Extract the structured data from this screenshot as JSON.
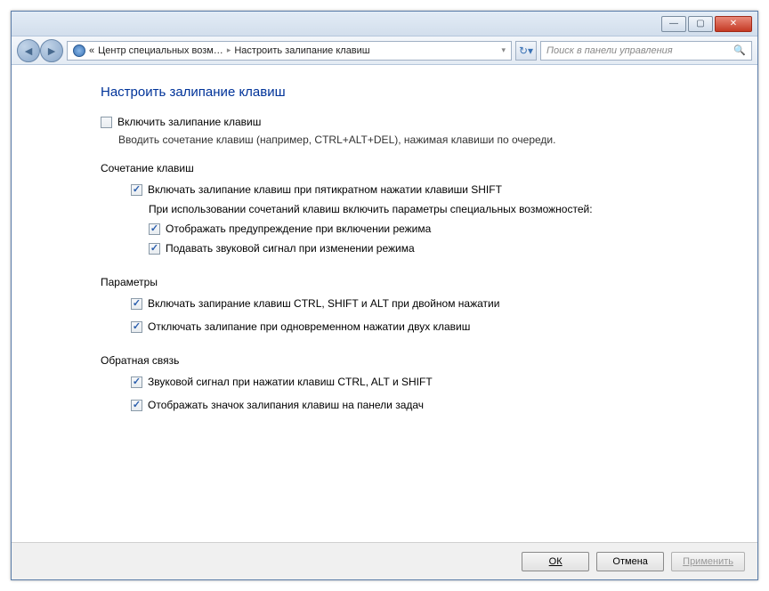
{
  "titlebar": {
    "minimize": "—",
    "maximize": "▢",
    "close": "✕"
  },
  "navbar": {
    "back_arrow": "◄",
    "fwd_arrow": "►",
    "crumb_prefix": "«",
    "crumb1": "Центр специальных возм…",
    "crumb2": "Настроить залипание клавиш",
    "separator": "▸",
    "dropdown": "▾",
    "refresh": "↻▾",
    "search_placeholder": "Поиск в панели управления",
    "search_icon": "🔍"
  },
  "page": {
    "title": "Настроить залипание клавиш",
    "main_checkbox_label": "Включить залипание клавиш",
    "main_description": "Вводить сочетание клавиш (например, CTRL+ALT+DEL), нажимая клавиши по очереди.",
    "sections": {
      "combo": {
        "header": "Сочетание клавиш",
        "opt1_label": "Включать залипание клавиш при пятикратном нажатии клавиши SHIFT",
        "subtext": "При использовании сочетаний клавиш включить параметры специальных возможностей:",
        "opt2_label": "Отображать предупреждение при включении режима",
        "opt3_label": "Подавать звуковой сигнал при изменении режима"
      },
      "params": {
        "header": "Параметры",
        "opt1_label": "Включать запирание клавиш CTRL, SHIFT и ALT при двойном нажатии",
        "opt2_label": "Отключать залипание при одновременном нажатии двух клавиш"
      },
      "feedback": {
        "header": "Обратная связь",
        "opt1_label": "Звуковой сигнал при нажатии клавиш CTRL, ALT и SHIFT",
        "opt2_label": "Отображать значок залипания клавиш на панели задач"
      }
    }
  },
  "buttons": {
    "ok": "ОК",
    "cancel": "Отмена",
    "apply": "Применить"
  },
  "checkbox_states": {
    "main_enable": false,
    "combo_opt1": true,
    "combo_opt2": true,
    "combo_opt3": true,
    "params_opt1": true,
    "params_opt2": true,
    "feedback_opt1": true,
    "feedback_opt2": true
  }
}
